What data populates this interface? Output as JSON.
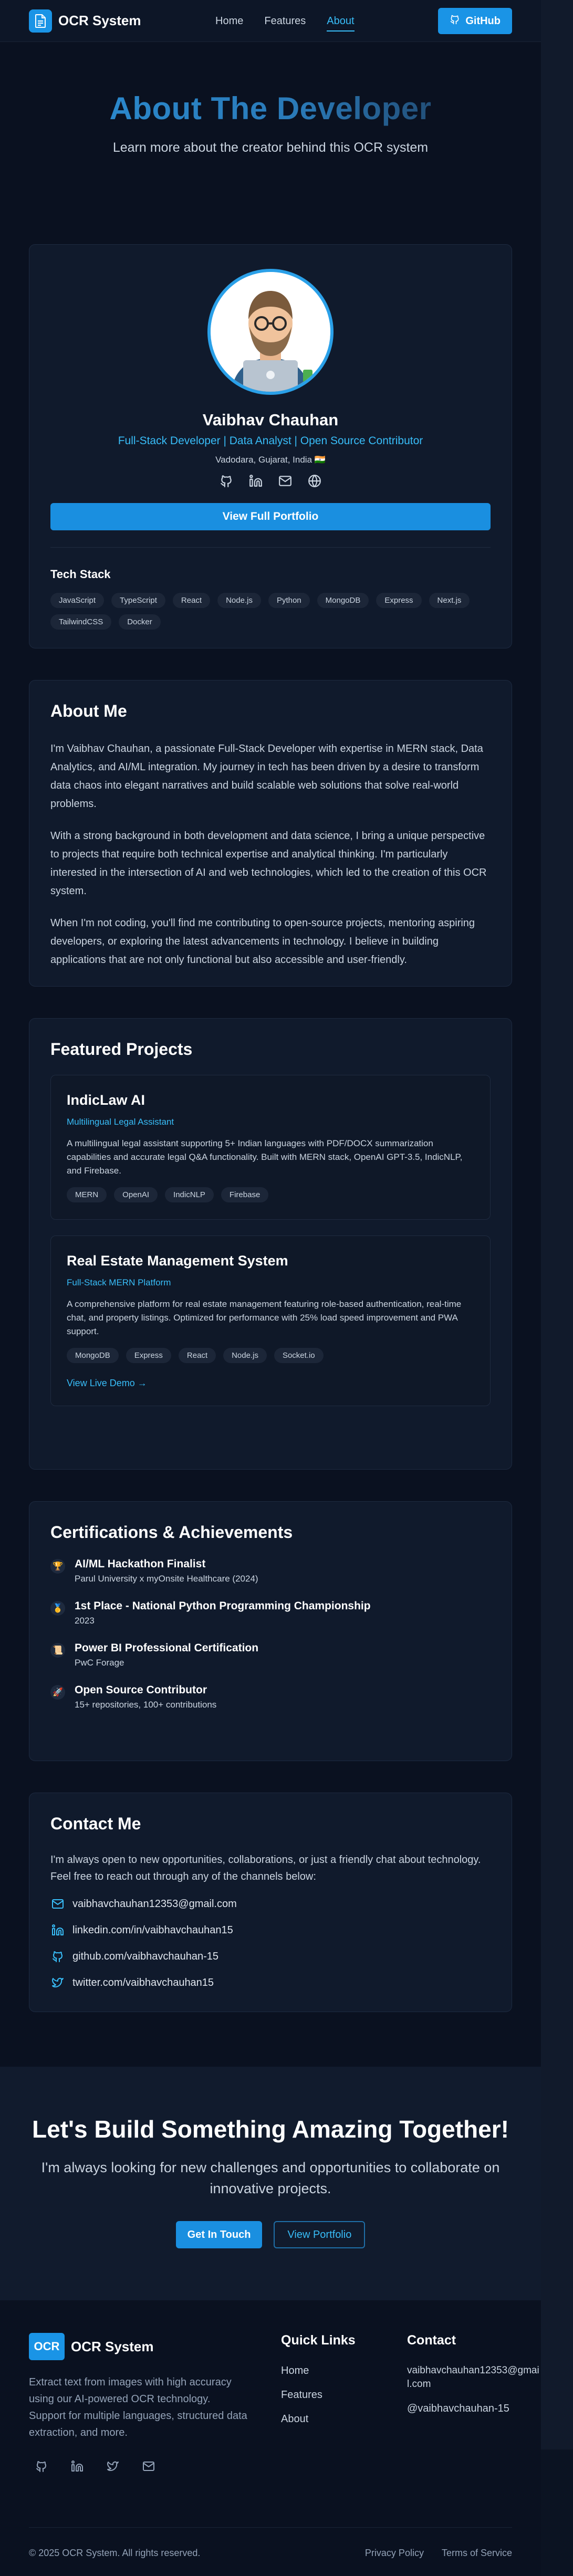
{
  "nav": {
    "logo_text": "OCR System",
    "links": [
      "Home",
      "Features",
      "About"
    ],
    "github_label": "GitHub"
  },
  "hero": {
    "title": "About The Developer",
    "subtitle": "Learn more about the creator behind this OCR system"
  },
  "profile": {
    "name": "Vaibhav Chauhan",
    "role": "Full-Stack Developer | Data Analyst | Open Source Contributor",
    "location": "Vadodara, Gujarat, India 🇮🇳",
    "portfolio_label": "View Full Portfolio",
    "tech_title": "Tech Stack",
    "tech": [
      "JavaScript",
      "TypeScript",
      "React",
      "Node.js",
      "Python",
      "MongoDB",
      "Express",
      "Next.js",
      "TailwindCSS",
      "Docker"
    ]
  },
  "about": {
    "title": "About Me",
    "paragraphs": [
      "I'm Vaibhav Chauhan, a passionate Full-Stack Developer with expertise in MERN stack, Data Analytics, and AI/ML integration. My journey in tech has been driven by a desire to transform data chaos into elegant narratives and build scalable web solutions that solve real-world problems.",
      "With a strong background in both development and data science, I bring a unique perspective to projects that require both technical expertise and analytical thinking. I'm particularly interested in the intersection of AI and web technologies, which led to the creation of this OCR system.",
      "When I'm not coding, you'll find me contributing to open-source projects, mentoring aspiring developers, or exploring the latest advancements in technology. I believe in building applications that are not only functional but also accessible and user-friendly."
    ]
  },
  "projects": {
    "title": "Featured Projects",
    "items": [
      {
        "name": "IndicLaw AI",
        "subtitle": "Multilingual Legal Assistant",
        "description": "A multilingual legal assistant supporting 5+ Indian languages with PDF/DOCX summarization capabilities and accurate legal Q&A functionality. Built with MERN stack, OpenAI GPT-3.5, IndicNLP, and Firebase.",
        "tags": [
          "MERN",
          "OpenAI",
          "IndicNLP",
          "Firebase"
        ]
      },
      {
        "name": "Real Estate Management System",
        "subtitle": "Full-Stack MERN Platform",
        "description": "A comprehensive platform for real estate management featuring role-based authentication, real-time chat, and property listings. Optimized for performance with 25% load speed improvement and PWA support.",
        "tags": [
          "MongoDB",
          "Express",
          "React",
          "Node.js",
          "Socket.io"
        ],
        "demo_label": "View Live Demo →"
      }
    ]
  },
  "certs": {
    "title": "Certifications & Achievements",
    "items": [
      {
        "icon": "🏆",
        "title": "AI/ML Hackathon Finalist",
        "sub": "Parul University x myOnsite Healthcare (2024)"
      },
      {
        "icon": "🥇",
        "title": "1st Place - National Python Programming Championship",
        "sub": "2023"
      },
      {
        "icon": "📜",
        "title": "Power BI Professional Certification",
        "sub": "PwC Forage"
      },
      {
        "icon": "🚀",
        "title": "Open Source Contributor",
        "sub": "15+ repositories, 100+ contributions"
      }
    ]
  },
  "contact": {
    "title": "Contact Me",
    "intro": "I'm always open to new opportunities, collaborations, or just a friendly chat about technology. Feel free to reach out through any of the channels below:",
    "email": "vaibhavchauhan12353@gmail.com",
    "linkedin": "linkedin.com/in/vaibhavchauhan15",
    "github": "github.com/vaibhavchauhan-15",
    "twitter": "twitter.com/vaibhavchauhan15"
  },
  "cta": {
    "title": "Let's Build Something Amazing Together!",
    "text": "I'm always looking for new challenges and opportunities to collaborate on innovative projects.",
    "primary": "Get In Touch",
    "secondary": "View Portfolio"
  },
  "footer": {
    "logo_box": "OCR",
    "logo_text": "OCR System",
    "description": "Extract text from images with high accuracy using our AI-powered OCR technology. Support for multiple languages, structured data extraction, and more.",
    "quick_title": "Quick Links",
    "quick_links": [
      "Home",
      "Features",
      "About"
    ],
    "contact_title": "Contact",
    "email": "vaibhavchauhan12353@gmail.com",
    "handle": "@vaibhavchauhan-15",
    "copyright": "© 2025 OCR System. All rights reserved.",
    "privacy": "Privacy Policy",
    "terms": "Terms of Service"
  },
  "colors": {
    "accent": "#1a94e6",
    "link": "#38bdf8",
    "background": "#0a1120",
    "card": "#101a2c"
  }
}
